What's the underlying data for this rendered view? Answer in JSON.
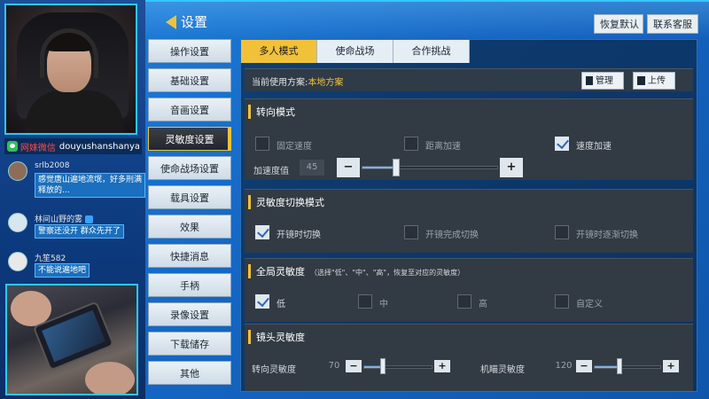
{
  "overlay": {
    "wechat_label": "网妹微信",
    "wechat_id": "douyushanshanya",
    "messages": [
      {
        "name": "srlb2008",
        "lines": [
          "感觉唐山遍地流氓，好多刑满",
          "释放的..."
        ]
      },
      {
        "name": "林间山野的雾",
        "lines": [
          "警察还没开 群众先开了"
        ]
      },
      {
        "name": "九笙582",
        "lines": [
          "不能说遍地吧"
        ]
      }
    ]
  },
  "game": {
    "title": "设置",
    "reset_label": "恢复默认",
    "service_label": "联系客服",
    "nav": [
      {
        "label": "操作设置",
        "active": false
      },
      {
        "label": "基础设置",
        "active": false
      },
      {
        "label": "音画设置",
        "active": false
      },
      {
        "label": "灵敏度设置",
        "active": true
      },
      {
        "label": "使命战场设置",
        "active": false
      },
      {
        "label": "载具设置",
        "active": false
      },
      {
        "label": "效果",
        "active": false
      },
      {
        "label": "快捷消息",
        "active": false
      },
      {
        "label": "手柄",
        "active": false
      },
      {
        "label": "录像设置",
        "active": false
      },
      {
        "label": "下载储存",
        "active": false
      },
      {
        "label": "其他",
        "active": false
      }
    ],
    "tabs": [
      {
        "label": "多人模式",
        "active": true
      },
      {
        "label": "使命战场",
        "active": false
      },
      {
        "label": "合作挑战",
        "active": false
      }
    ],
    "scheme": {
      "label": "当前使用方案:",
      "value": "本地方案",
      "manage_label": "管理",
      "upload_label": "上传"
    },
    "turn_mode": {
      "title": "转向模式",
      "options": [
        {
          "label": "固定速度",
          "checked": false
        },
        {
          "label": "距离加速",
          "checked": false
        },
        {
          "label": "速度加速",
          "checked": true
        }
      ],
      "accel_label": "加速度值",
      "accel_value": "45",
      "accel_fraction": 0.25
    },
    "switch_mode": {
      "title": "灵敏度切换模式",
      "options": [
        {
          "label": "开镜时切换",
          "checked": true
        },
        {
          "label": "开镜完成切换",
          "checked": false
        },
        {
          "label": "开镜时逐渐切换",
          "checked": false
        }
      ]
    },
    "global_sens": {
      "title": "全局灵敏度",
      "note": "（选择\"低\"、\"中\"、\"高\"，恢复至对应的灵敏度）",
      "options": [
        {
          "label": "低",
          "checked": true
        },
        {
          "label": "中",
          "checked": false
        },
        {
          "label": "高",
          "checked": false
        },
        {
          "label": "自定义",
          "checked": false
        }
      ]
    },
    "lens_sens": {
      "title": "镜头灵敏度",
      "turn_label": "转向灵敏度",
      "turn_value": "70",
      "turn_fraction": 0.28,
      "aim_label": "机瞄灵敏度",
      "aim_value": "120",
      "aim_fraction": 0.38
    },
    "minus": "−",
    "plus": "+"
  },
  "colors": {
    "accent": "#f2c13a",
    "check": "#2a64b8",
    "background": "#1565c2"
  }
}
